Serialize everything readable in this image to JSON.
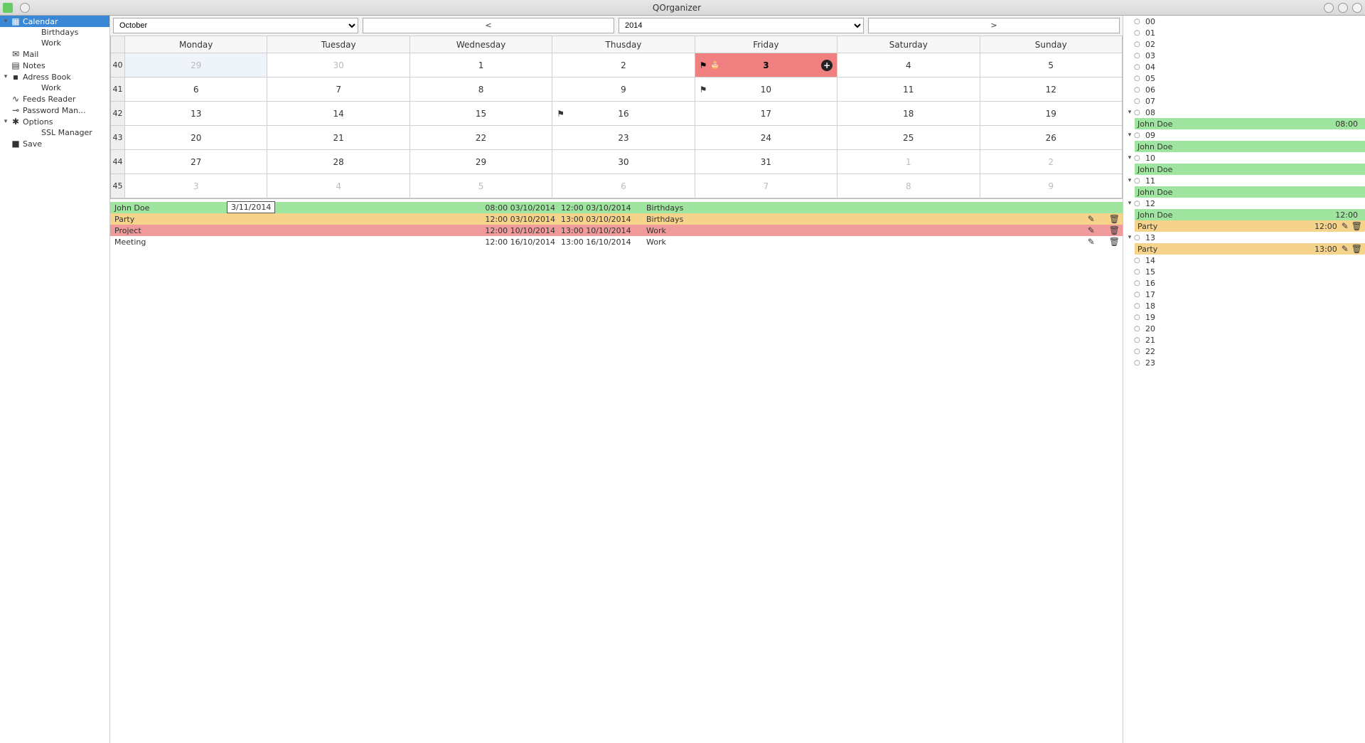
{
  "window": {
    "title": "QOrganizer"
  },
  "sidebar": {
    "items": [
      {
        "label": "Calendar",
        "icon": "▦",
        "expandable": true,
        "selected": true
      },
      {
        "label": "Birthdays",
        "child": true
      },
      {
        "label": "Work",
        "child": true
      },
      {
        "label": "Mail",
        "icon": "✉"
      },
      {
        "label": "Notes",
        "icon": "▤"
      },
      {
        "label": "Adress Book",
        "icon": "▪",
        "expandable": true
      },
      {
        "label": "Work",
        "child": true
      },
      {
        "label": "Feeds Reader",
        "icon": "∿"
      },
      {
        "label": "Password Man...",
        "icon": "⊸"
      },
      {
        "label": "Options",
        "icon": "✱",
        "expandable": true
      },
      {
        "label": "SSL Manager",
        "child": true
      },
      {
        "label": "Save",
        "icon": "■"
      }
    ]
  },
  "nav": {
    "month": "October",
    "prev": "<",
    "year": "2014",
    "next": ">"
  },
  "calendar": {
    "days": [
      "Monday",
      "Tuesday",
      "Wednesday",
      "Thusday",
      "Friday",
      "Saturday",
      "Sunday"
    ],
    "weeks": [
      {
        "wk": "40",
        "cells": [
          {
            "n": "29",
            "out": true,
            "sel": true
          },
          {
            "n": "30",
            "out": true
          },
          {
            "n": "1"
          },
          {
            "n": "2"
          },
          {
            "n": "3",
            "today": true,
            "flag": true,
            "birthday": true
          },
          {
            "n": "4"
          },
          {
            "n": "5"
          }
        ]
      },
      {
        "wk": "41",
        "cells": [
          {
            "n": "6"
          },
          {
            "n": "7"
          },
          {
            "n": "8"
          },
          {
            "n": "9"
          },
          {
            "n": "10",
            "flag": true
          },
          {
            "n": "11"
          },
          {
            "n": "12"
          }
        ]
      },
      {
        "wk": "42",
        "cells": [
          {
            "n": "13"
          },
          {
            "n": "14"
          },
          {
            "n": "15"
          },
          {
            "n": "16",
            "flag": true
          },
          {
            "n": "17"
          },
          {
            "n": "18"
          },
          {
            "n": "19"
          }
        ]
      },
      {
        "wk": "43",
        "cells": [
          {
            "n": "20"
          },
          {
            "n": "21"
          },
          {
            "n": "22"
          },
          {
            "n": "23"
          },
          {
            "n": "24"
          },
          {
            "n": "25"
          },
          {
            "n": "26"
          }
        ]
      },
      {
        "wk": "44",
        "cells": [
          {
            "n": "27"
          },
          {
            "n": "28"
          },
          {
            "n": "29"
          },
          {
            "n": "30"
          },
          {
            "n": "31"
          },
          {
            "n": "1",
            "out": true
          },
          {
            "n": "2",
            "out": true
          }
        ]
      },
      {
        "wk": "45",
        "cells": [
          {
            "n": "3",
            "out": true
          },
          {
            "n": "4",
            "out": true
          },
          {
            "n": "5",
            "out": true
          },
          {
            "n": "6",
            "out": true
          },
          {
            "n": "7",
            "out": true
          },
          {
            "n": "8",
            "out": true
          },
          {
            "n": "9",
            "out": true
          }
        ]
      }
    ]
  },
  "events": {
    "date_box": "3/11/2014",
    "rows": [
      {
        "name": "John Doe",
        "start": "08:00 03/10/2014",
        "end": "12:00 03/10/2014",
        "cat": "Birthdays",
        "cls": "ev-green",
        "actions": false
      },
      {
        "name": "Party",
        "start": "12:00 03/10/2014",
        "end": "13:00 03/10/2014",
        "cat": "Birthdays",
        "cls": "ev-orange",
        "actions": true
      },
      {
        "name": "Project",
        "start": "12:00 10/10/2014",
        "end": "13:00 10/10/2014",
        "cat": "Work",
        "cls": "ev-red",
        "actions": true
      },
      {
        "name": "Meeting",
        "start": "12:00 16/10/2014",
        "end": "13:00 16/10/2014",
        "cat": "Work",
        "cls": "ev-white",
        "actions": true
      }
    ]
  },
  "hours": [
    {
      "h": "00"
    },
    {
      "h": "01"
    },
    {
      "h": "02"
    },
    {
      "h": "03"
    },
    {
      "h": "04"
    },
    {
      "h": "05"
    },
    {
      "h": "06"
    },
    {
      "h": "07"
    },
    {
      "h": "08",
      "open": true,
      "ev": [
        {
          "name": "John Doe",
          "time": "08:00",
          "cls": "he-green"
        }
      ]
    },
    {
      "h": "09",
      "open": true,
      "ev": [
        {
          "name": "John Doe",
          "time": "",
          "cls": "he-green"
        }
      ]
    },
    {
      "h": "10",
      "open": true,
      "ev": [
        {
          "name": "John Doe",
          "time": "",
          "cls": "he-green"
        }
      ]
    },
    {
      "h": "11",
      "open": true,
      "ev": [
        {
          "name": "John Doe",
          "time": "",
          "cls": "he-green"
        }
      ]
    },
    {
      "h": "12",
      "open": true,
      "ev": [
        {
          "name": "John Doe",
          "time": "12:00",
          "cls": "he-green"
        },
        {
          "name": "Party",
          "time": "12:00",
          "cls": "he-orange",
          "actions": true
        }
      ]
    },
    {
      "h": "13",
      "open": true,
      "ev": [
        {
          "name": "Party",
          "time": "13:00",
          "cls": "he-orange",
          "actions": true
        }
      ]
    },
    {
      "h": "14"
    },
    {
      "h": "15"
    },
    {
      "h": "16"
    },
    {
      "h": "17"
    },
    {
      "h": "18"
    },
    {
      "h": "19"
    },
    {
      "h": "20"
    },
    {
      "h": "21"
    },
    {
      "h": "22"
    },
    {
      "h": "23"
    }
  ]
}
